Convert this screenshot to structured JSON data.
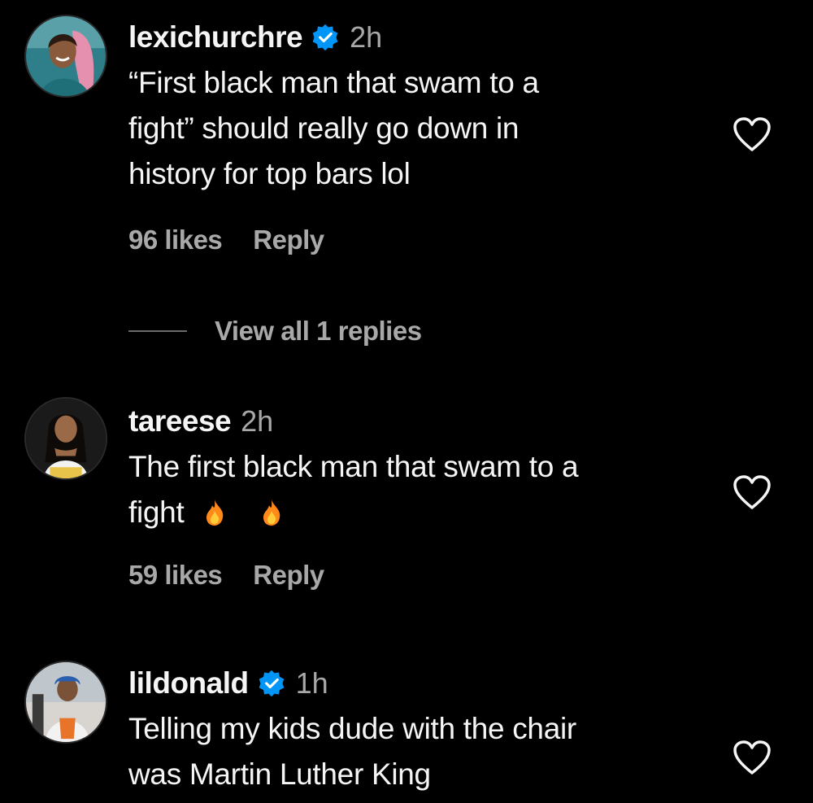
{
  "comments": [
    {
      "username": "lexichurchre",
      "verified": true,
      "time": "2h",
      "text_lines": [
        "“First black man that swam to a",
        "fight” should really go down in",
        "history for top bars lol"
      ],
      "likes": "96 likes",
      "reply_label": "Reply",
      "view_replies": "View all 1 replies"
    },
    {
      "username": "tareese",
      "verified": false,
      "time": "2h",
      "text_lines": [
        "The first black man that swam to a",
        "fight"
      ],
      "emoji_icons": [
        "fire-emoji",
        "fire-emoji"
      ],
      "likes": "59 likes",
      "reply_label": "Reply"
    },
    {
      "username": "lildonald",
      "verified": true,
      "time": "1h",
      "text_lines": [
        "Telling my kids dude with the chair",
        "was Martin Luther King"
      ]
    }
  ],
  "icons": {
    "verified": "verified-badge-icon",
    "like": "heart-outline-icon"
  },
  "colors": {
    "background": "#000000",
    "text": "#f5f5f5",
    "secondary": "#a8a8a8",
    "verified": "#0095f6",
    "flame": "#ff8a1a"
  }
}
